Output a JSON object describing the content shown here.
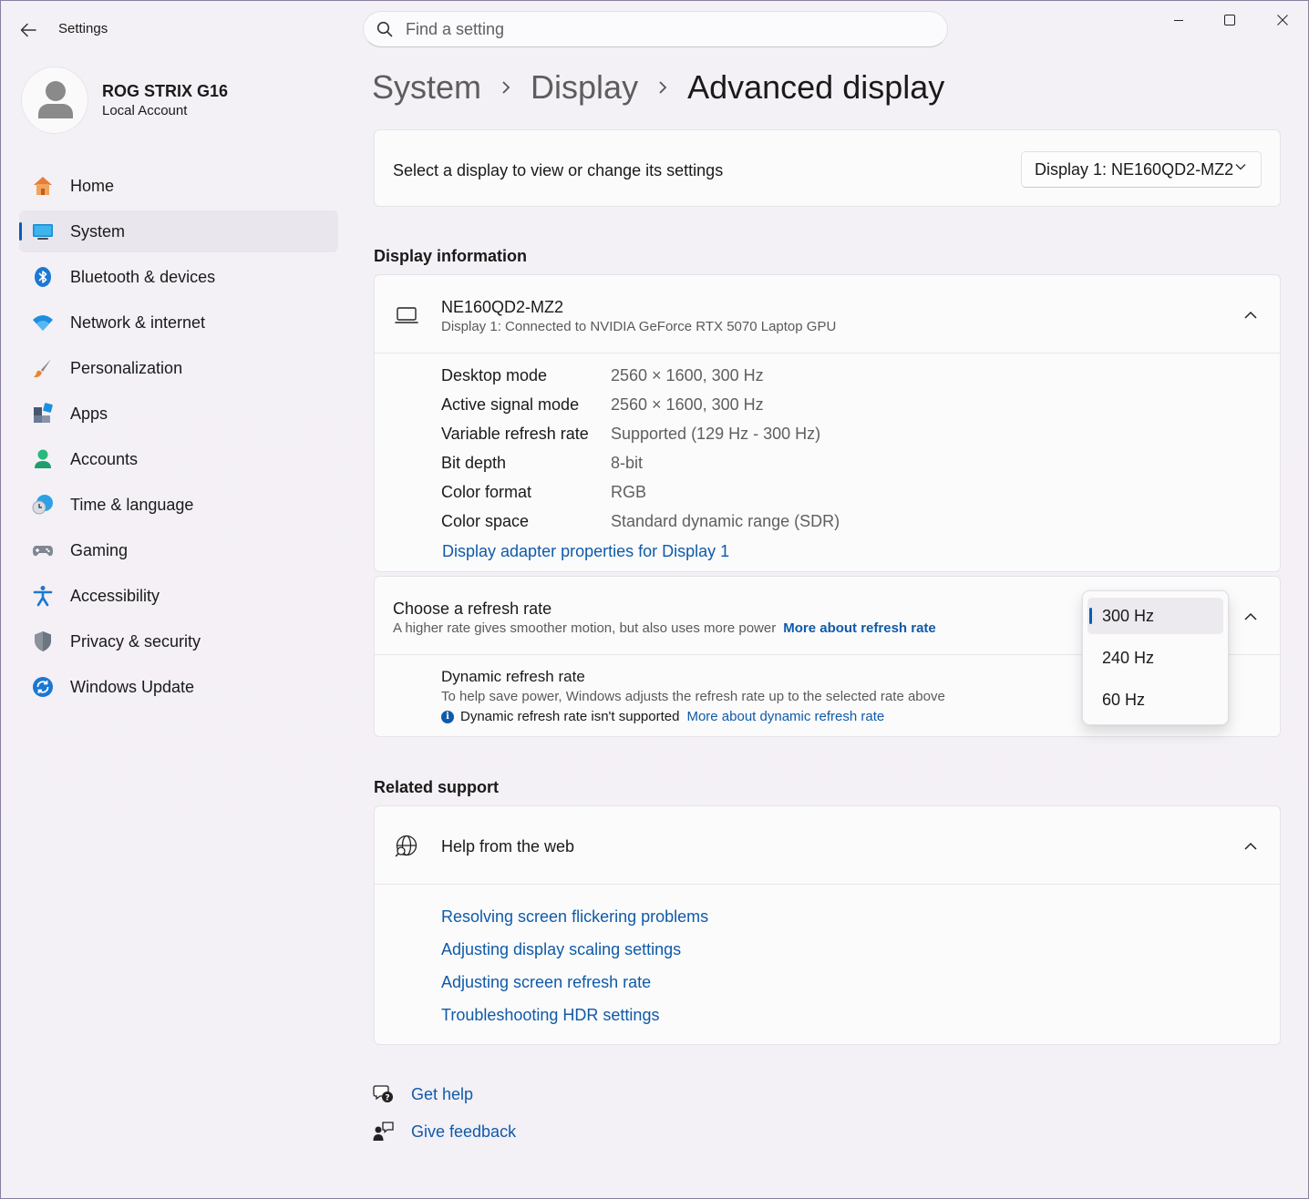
{
  "window": {
    "app_title": "Settings",
    "search_placeholder": "Find a setting"
  },
  "profile": {
    "name": "ROG STRIX G16",
    "account_type": "Local Account"
  },
  "nav": {
    "items": [
      {
        "label": "Home",
        "icon": "home-icon"
      },
      {
        "label": "System",
        "icon": "system-icon",
        "selected": true
      },
      {
        "label": "Bluetooth & devices",
        "icon": "bluetooth-icon"
      },
      {
        "label": "Network & internet",
        "icon": "wifi-icon"
      },
      {
        "label": "Personalization",
        "icon": "brush-icon"
      },
      {
        "label": "Apps",
        "icon": "apps-icon"
      },
      {
        "label": "Accounts",
        "icon": "accounts-icon"
      },
      {
        "label": "Time & language",
        "icon": "clock-globe-icon"
      },
      {
        "label": "Gaming",
        "icon": "gamepad-icon"
      },
      {
        "label": "Accessibility",
        "icon": "accessibility-icon"
      },
      {
        "label": "Privacy & security",
        "icon": "shield-icon"
      },
      {
        "label": "Windows Update",
        "icon": "update-icon"
      }
    ]
  },
  "breadcrumb": {
    "items": [
      "System",
      "Display",
      "Advanced display"
    ]
  },
  "select_display": {
    "label": "Select a display to view or change its settings",
    "selected": "Display 1: NE160QD2-MZ2"
  },
  "display_info": {
    "section_title": "Display information",
    "device_name": "NE160QD2-MZ2",
    "device_sub": "Display 1: Connected to NVIDIA GeForce RTX 5070 Laptop GPU",
    "rows": [
      {
        "key": "Desktop mode",
        "value": "2560 × 1600, 300 Hz"
      },
      {
        "key": "Active signal mode",
        "value": "2560 × 1600, 300 Hz"
      },
      {
        "key": "Variable refresh rate",
        "value": "Supported (129 Hz - 300 Hz)"
      },
      {
        "key": "Bit depth",
        "value": "8-bit"
      },
      {
        "key": "Color format",
        "value": "RGB"
      },
      {
        "key": "Color space",
        "value": "Standard dynamic range (SDR)"
      }
    ],
    "adapter_link": "Display adapter properties for Display 1"
  },
  "refresh_rate": {
    "title": "Choose a refresh rate",
    "subtitle": "A higher rate gives smoother motion, but also uses more power",
    "more_link": "More about refresh rate",
    "options": [
      "300 Hz",
      "240 Hz",
      "60 Hz"
    ],
    "selected": "300 Hz",
    "dynamic_title": "Dynamic refresh rate",
    "dynamic_sub": "To help save power, Windows adjusts the refresh rate up to the selected rate above",
    "dynamic_note": "Dynamic refresh rate isn't supported",
    "dynamic_link": "More about dynamic refresh rate"
  },
  "related_support": {
    "section_title": "Related support",
    "help_title": "Help from the web",
    "links": [
      "Resolving screen flickering problems",
      "Adjusting display scaling settings",
      "Adjusting screen refresh rate",
      "Troubleshooting HDR settings"
    ]
  },
  "footer": {
    "get_help": "Get help",
    "give_feedback": "Give feedback"
  },
  "colors": {
    "accent": "#005fb8",
    "link": "#0f5aa8"
  }
}
